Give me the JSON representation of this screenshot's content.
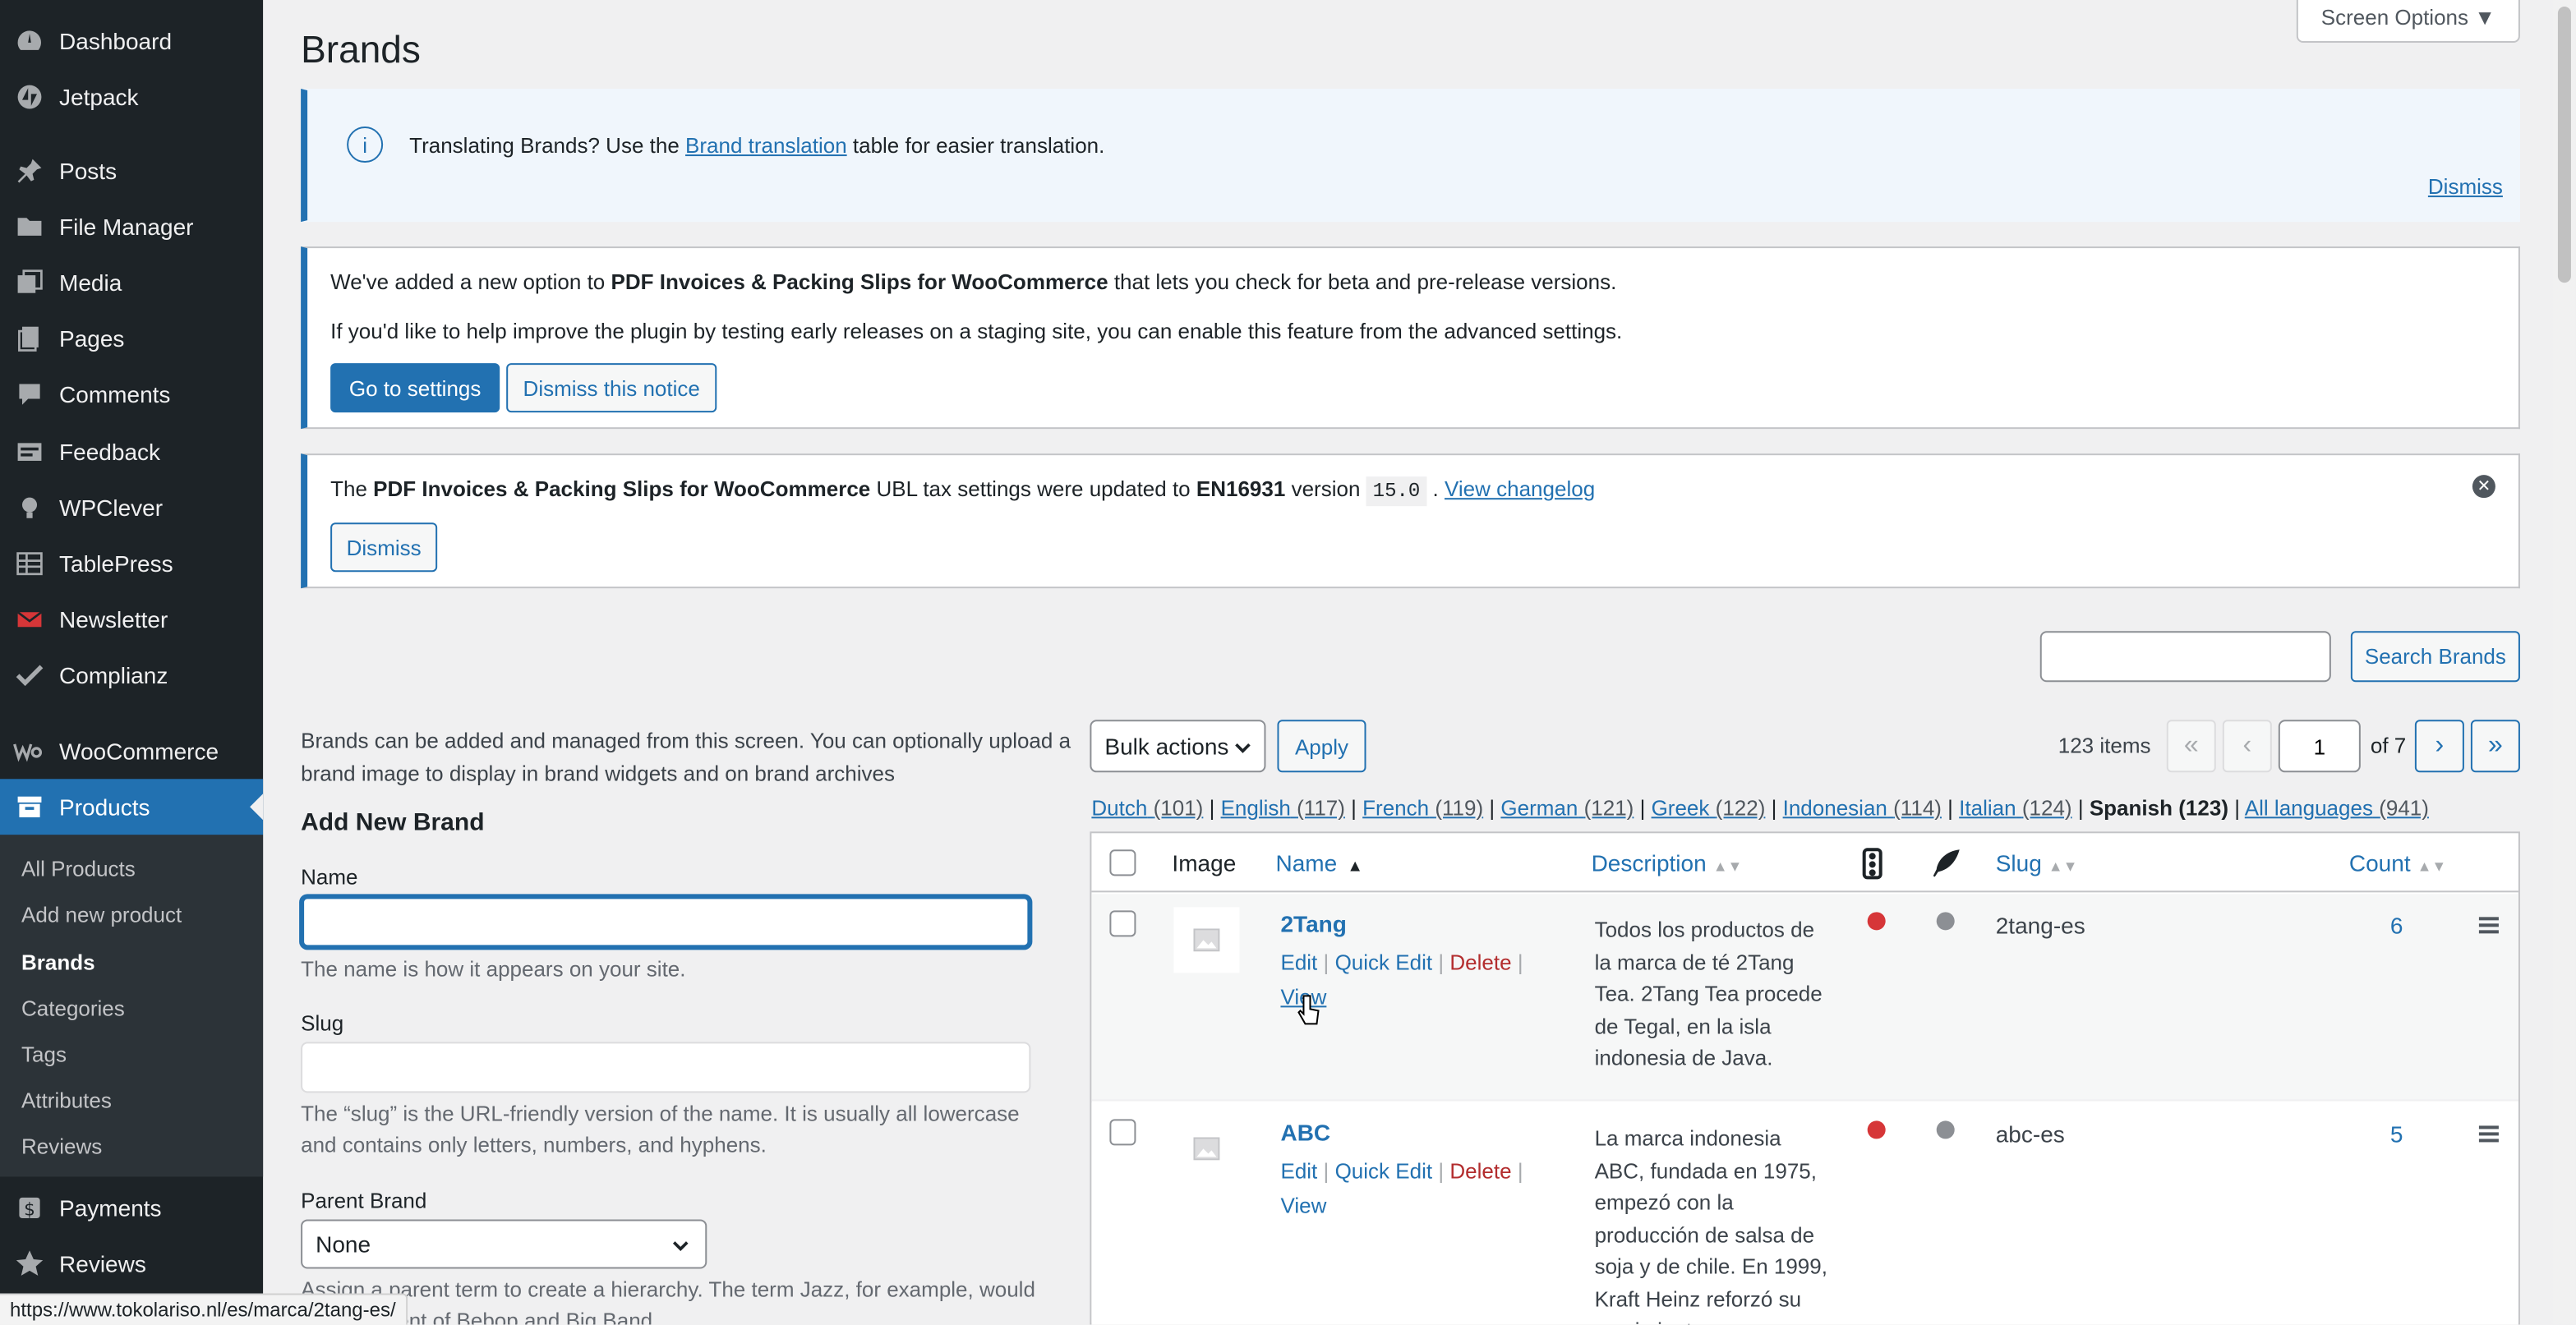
{
  "sidebar": {
    "items": [
      {
        "label": "Dashboard",
        "icon": "dashboard-icon"
      },
      {
        "label": "Jetpack",
        "icon": "jetpack-icon"
      },
      {
        "label": "Posts",
        "icon": "pin-icon"
      },
      {
        "label": "File Manager",
        "icon": "folder-icon"
      },
      {
        "label": "Media",
        "icon": "media-icon"
      },
      {
        "label": "Pages",
        "icon": "pages-icon"
      },
      {
        "label": "Comments",
        "icon": "comment-icon"
      },
      {
        "label": "Feedback",
        "icon": "feedback-icon"
      },
      {
        "label": "WPClever",
        "icon": "bulb-icon"
      },
      {
        "label": "TablePress",
        "icon": "table-icon"
      },
      {
        "label": "Newsletter",
        "icon": "envelope-icon"
      },
      {
        "label": "Complianz",
        "icon": "check-icon"
      },
      {
        "label": "WooCommerce",
        "icon": "woo-icon"
      },
      {
        "label": "Products",
        "icon": "archive-icon"
      },
      {
        "label": "Payments",
        "icon": "dollar-icon"
      },
      {
        "label": "Reviews",
        "icon": "star-icon"
      }
    ],
    "submenu": [
      "All Products",
      "Add new product",
      "Brands",
      "Categories",
      "Tags",
      "Attributes",
      "Reviews"
    ]
  },
  "screen_options": "Screen Options ▼",
  "page_title": "Brands",
  "notice_translate": {
    "text_before": "Translating Brands? Use the ",
    "link": "Brand translation",
    "text_after": " table for easier translation.",
    "dismiss": "Dismiss"
  },
  "notice_pdf": {
    "line1_before": "We've added a new option to ",
    "line1_bold": "PDF Invoices & Packing Slips for WooCommerce",
    "line1_after": " that lets you check for beta and pre-release versions.",
    "line2": "If you'd like to help improve the plugin by testing early releases on a staging site, you can enable this feature from the advanced settings.",
    "btn_settings": "Go to settings",
    "btn_dismiss": "Dismiss this notice"
  },
  "notice_ubl": {
    "t1": "The ",
    "b1": "PDF Invoices & Packing Slips for WooCommerce",
    "t2": " UBL tax settings were updated to ",
    "b2": "EN16931",
    "t3": " version ",
    "code": "15.0",
    "t4": " . ",
    "link": "View changelog",
    "btn_dismiss": "Dismiss"
  },
  "search": {
    "placeholder": "",
    "button": "Search Brands"
  },
  "intro": "Brands can be added and managed from this screen. You can optionally upload a brand image to display in brand widgets and on brand archives",
  "form": {
    "heading": "Add New Brand",
    "name_label": "Name",
    "name_value": "",
    "name_help": "The name is how it appears on your site.",
    "slug_label": "Slug",
    "slug_help": "The “slug” is the URL-friendly version of the name. It is usually all lowercase and contains only letters, numbers, and hyphens.",
    "parent_label": "Parent Brand",
    "parent_value": "None",
    "parent_help": "Assign a parent term to create a hierarchy. The term Jazz, for example, would be the parent of Bebop and Big Band."
  },
  "tablenav": {
    "bulk": "Bulk actions",
    "apply": "Apply",
    "items": "123 items",
    "first": "«",
    "prev": "‹",
    "page": "1",
    "of": "of 7",
    "next": "›",
    "last": "»"
  },
  "languages": [
    {
      "name": "Dutch",
      "count": "(101)"
    },
    {
      "name": "English",
      "count": "(117)"
    },
    {
      "name": "French",
      "count": "(119)"
    },
    {
      "name": "German",
      "count": "(121)"
    },
    {
      "name": "Greek",
      "count": "(122)"
    },
    {
      "name": "Indonesian",
      "count": "(114)"
    },
    {
      "name": "Italian",
      "count": "(124)"
    },
    {
      "name": "Spanish",
      "count": "(123)"
    },
    {
      "name": "All languages",
      "count": "(941)"
    }
  ],
  "table": {
    "headers": {
      "image": "Image",
      "name": "Name",
      "description": "Description",
      "slug": "Slug",
      "count": "Count"
    },
    "rows": [
      {
        "name": "2Tang",
        "actions": [
          "Edit",
          "Quick Edit",
          "Delete",
          "View"
        ],
        "description": [
          "Todos los productos de",
          "la marca de té 2Tang",
          "Tea. 2Tang Tea procede",
          "de Tegal, en la isla",
          "indonesia de Java."
        ],
        "slug": "2tang-es",
        "count": "6"
      },
      {
        "name": "ABC",
        "actions": [
          "Edit",
          "Quick Edit",
          "Delete",
          "View"
        ],
        "description": [
          "La marca indonesia",
          "ABC, fundada en 1975,",
          "empezó con la",
          "producción de salsa de",
          "soja y de chile. En 1999,",
          "Kraft Heinz reforzó su",
          "crecimiento"
        ],
        "slug": "abc-es",
        "count": "5"
      }
    ]
  },
  "status_url": "https://www.tokolariso.nl/es/marca/2tang-es/",
  "colors": {
    "accent": "#2271b1",
    "sidebar": "#1d2327",
    "red_dot": "#d63638",
    "grey_dot": "#8c8f94"
  }
}
